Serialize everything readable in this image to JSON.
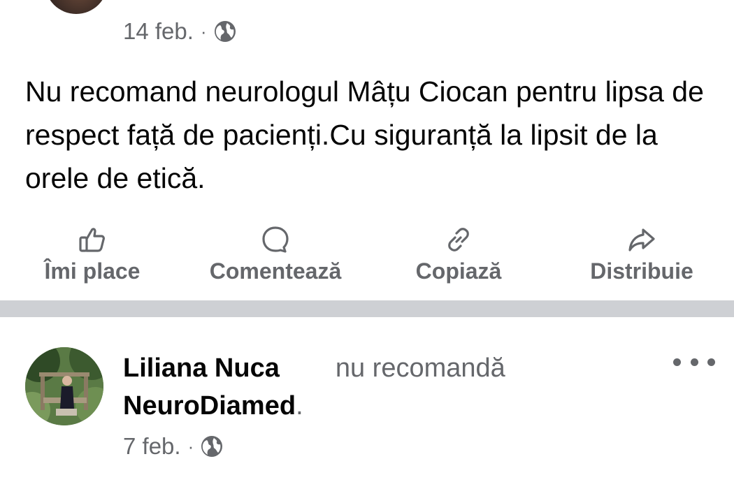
{
  "post1": {
    "date": "14 feb.",
    "separator": "·",
    "privacy_icon": "globe-icon",
    "text": "Nu recomand neurologul Mâțu Ciocan pentru lipsa de respect față de pacienți.Cu siguranță la lipsit de la orele de etică."
  },
  "actions": {
    "like": {
      "label": "Îmi place",
      "icon": "thumbs-up-icon"
    },
    "comment": {
      "label": "Comentează",
      "icon": "comment-bubble-icon"
    },
    "copy": {
      "label": "Copiază",
      "icon": "link-icon"
    },
    "share": {
      "label": "Distribuie",
      "icon": "share-arrow-icon"
    }
  },
  "post2": {
    "author": "Liliana Nuca",
    "verb": "nu recomandă",
    "page": "NeuroDiamed",
    "period": ".",
    "date": "7 feb.",
    "separator": "·",
    "privacy_icon": "globe-icon",
    "more_icon": "more-dots-icon"
  },
  "colors": {
    "text": "#050505",
    "secondary": "#65676b",
    "divider": "#ced0d4",
    "background": "#ffffff"
  }
}
